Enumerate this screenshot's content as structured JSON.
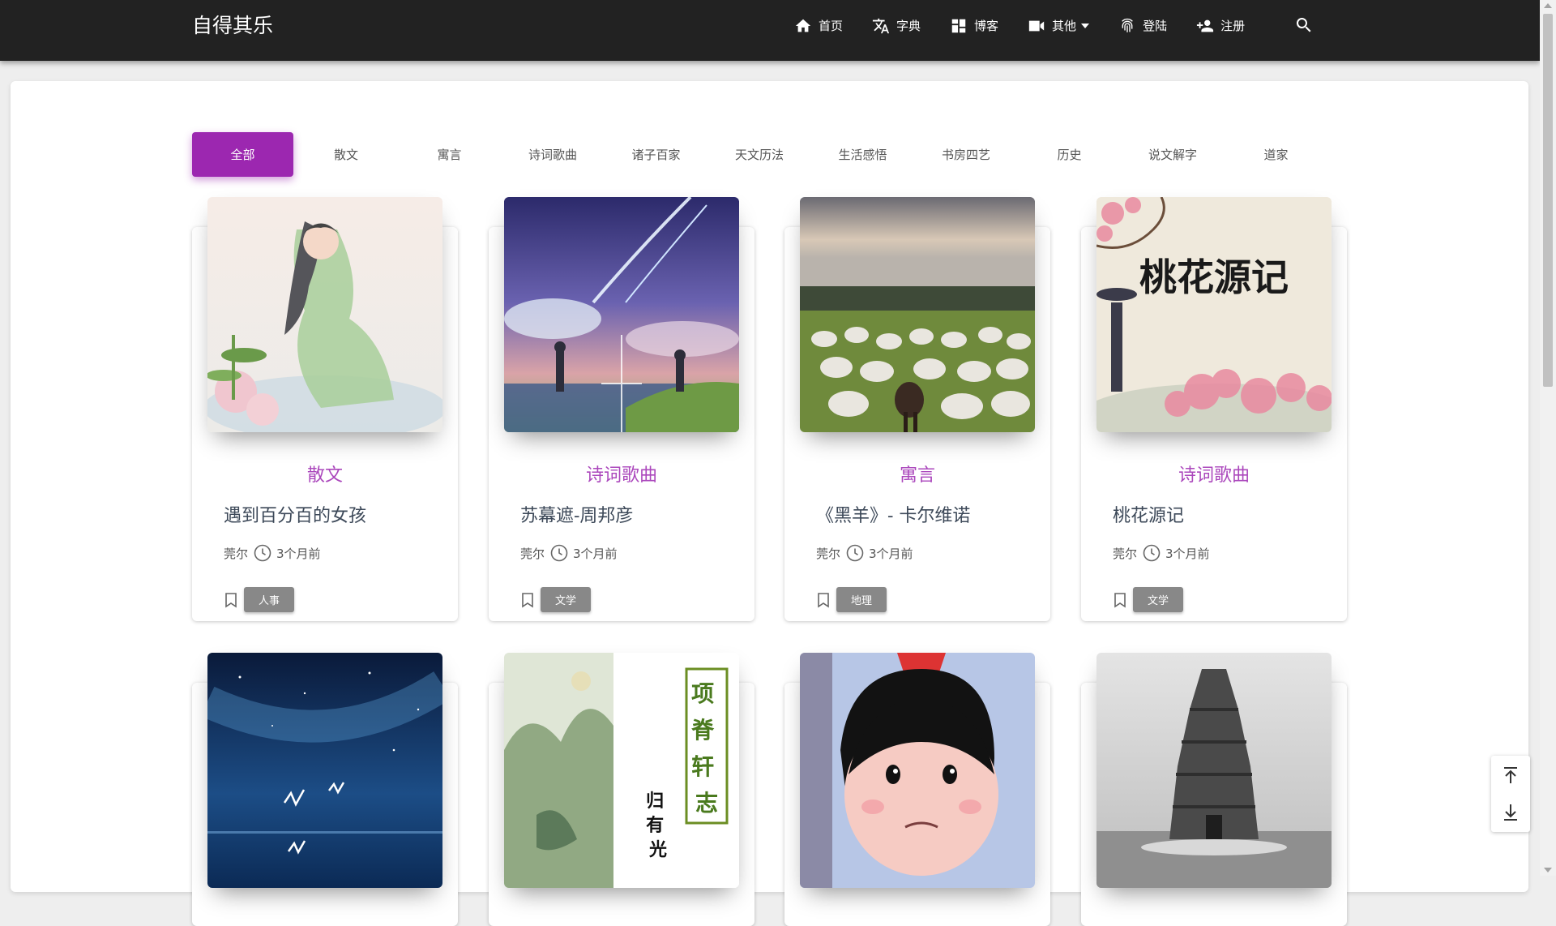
{
  "brand": "自得其乐",
  "nav": {
    "items": [
      {
        "label": "首页",
        "icon": "home-icon"
      },
      {
        "label": "字典",
        "icon": "translate-icon"
      },
      {
        "label": "博客",
        "icon": "dashboard-icon"
      },
      {
        "label": "其他",
        "icon": "video-icon",
        "dropdown": true
      },
      {
        "label": "登陆",
        "icon": "fingerprint-icon"
      },
      {
        "label": "注册",
        "icon": "person-add-icon"
      }
    ],
    "search_icon": "search-icon"
  },
  "categories": {
    "active": "全部",
    "tabs": [
      "全部",
      "散文",
      "寓言",
      "诗词歌曲",
      "诸子百家",
      "天文历法",
      "生活感悟",
      "书房四艺",
      "历史",
      "说文解字",
      "道家"
    ]
  },
  "cards": [
    {
      "category": "散文",
      "title": "遇到百分百的女孩",
      "author": "莞尔",
      "time": "3个月前",
      "tag": "人事",
      "image": "painting of woman in green robe with lotus"
    },
    {
      "category": "诗词歌曲",
      "title": "苏幕遮-周邦彦",
      "author": "莞尔",
      "time": "3个月前",
      "tag": "文学",
      "image": "anime sky with comet and two figures"
    },
    {
      "category": "寓言",
      "title": "《黑羊》- 卡尔维诺",
      "author": "莞尔",
      "time": "3个月前",
      "tag": "地理",
      "image": "flock of white sheep with one black sheep"
    },
    {
      "category": "诗词歌曲",
      "title": "桃花源记",
      "author": "莞尔",
      "time": "3个月前",
      "tag": "文学",
      "image": "peach blossom painting with calligraphy"
    },
    {
      "image": "night sky over sea with birds"
    },
    {
      "image": "ink painting with vertical calligraphy",
      "calligraphy_title": "项脊轩志",
      "calligraphy_author": "归有光"
    },
    {
      "image": "cartoon girl with bob haircut"
    },
    {
      "image": "black and white photo of ancient pagoda"
    }
  ],
  "calligraphy_peach": "桃花源记",
  "colors": {
    "accent": "#9c27b0",
    "category_text": "#ab47bc",
    "navbar": "#222222",
    "tag": "#888888"
  }
}
